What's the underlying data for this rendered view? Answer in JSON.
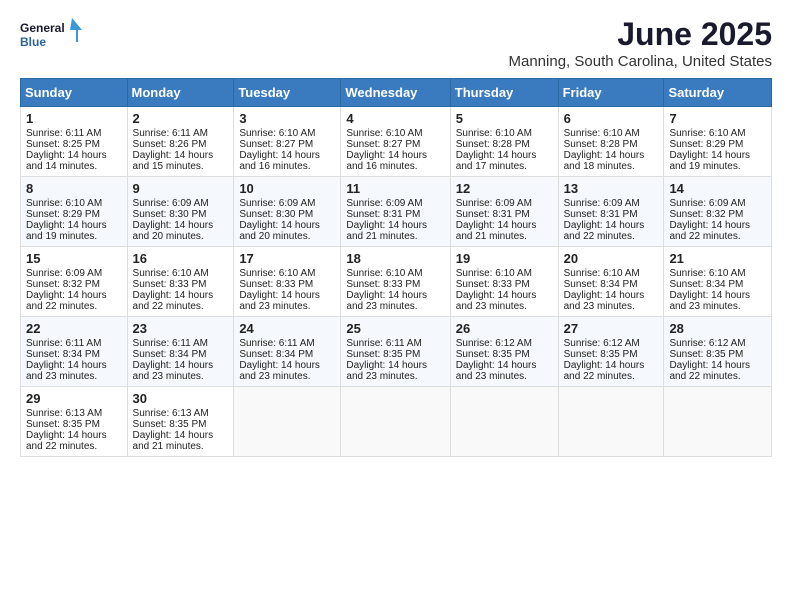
{
  "header": {
    "logo_line1": "General",
    "logo_line2": "Blue",
    "title": "June 2025",
    "subtitle": "Manning, South Carolina, United States"
  },
  "calendar": {
    "weekdays": [
      "Sunday",
      "Monday",
      "Tuesday",
      "Wednesday",
      "Thursday",
      "Friday",
      "Saturday"
    ],
    "weeks": [
      [
        {
          "day": "1",
          "info": "Sunrise: 6:11 AM\nSunset: 8:25 PM\nDaylight: 14 hours and 14 minutes."
        },
        {
          "day": "2",
          "info": "Sunrise: 6:11 AM\nSunset: 8:26 PM\nDaylight: 14 hours and 15 minutes."
        },
        {
          "day": "3",
          "info": "Sunrise: 6:10 AM\nSunset: 8:27 PM\nDaylight: 14 hours and 16 minutes."
        },
        {
          "day": "4",
          "info": "Sunrise: 6:10 AM\nSunset: 8:27 PM\nDaylight: 14 hours and 16 minutes."
        },
        {
          "day": "5",
          "info": "Sunrise: 6:10 AM\nSunset: 8:28 PM\nDaylight: 14 hours and 17 minutes."
        },
        {
          "day": "6",
          "info": "Sunrise: 6:10 AM\nSunset: 8:28 PM\nDaylight: 14 hours and 18 minutes."
        },
        {
          "day": "7",
          "info": "Sunrise: 6:10 AM\nSunset: 8:29 PM\nDaylight: 14 hours and 19 minutes."
        }
      ],
      [
        {
          "day": "8",
          "info": "Sunrise: 6:10 AM\nSunset: 8:29 PM\nDaylight: 14 hours and 19 minutes."
        },
        {
          "day": "9",
          "info": "Sunrise: 6:09 AM\nSunset: 8:30 PM\nDaylight: 14 hours and 20 minutes."
        },
        {
          "day": "10",
          "info": "Sunrise: 6:09 AM\nSunset: 8:30 PM\nDaylight: 14 hours and 20 minutes."
        },
        {
          "day": "11",
          "info": "Sunrise: 6:09 AM\nSunset: 8:31 PM\nDaylight: 14 hours and 21 minutes."
        },
        {
          "day": "12",
          "info": "Sunrise: 6:09 AM\nSunset: 8:31 PM\nDaylight: 14 hours and 21 minutes."
        },
        {
          "day": "13",
          "info": "Sunrise: 6:09 AM\nSunset: 8:31 PM\nDaylight: 14 hours and 22 minutes."
        },
        {
          "day": "14",
          "info": "Sunrise: 6:09 AM\nSunset: 8:32 PM\nDaylight: 14 hours and 22 minutes."
        }
      ],
      [
        {
          "day": "15",
          "info": "Sunrise: 6:09 AM\nSunset: 8:32 PM\nDaylight: 14 hours and 22 minutes."
        },
        {
          "day": "16",
          "info": "Sunrise: 6:10 AM\nSunset: 8:33 PM\nDaylight: 14 hours and 22 minutes."
        },
        {
          "day": "17",
          "info": "Sunrise: 6:10 AM\nSunset: 8:33 PM\nDaylight: 14 hours and 23 minutes."
        },
        {
          "day": "18",
          "info": "Sunrise: 6:10 AM\nSunset: 8:33 PM\nDaylight: 14 hours and 23 minutes."
        },
        {
          "day": "19",
          "info": "Sunrise: 6:10 AM\nSunset: 8:33 PM\nDaylight: 14 hours and 23 minutes."
        },
        {
          "day": "20",
          "info": "Sunrise: 6:10 AM\nSunset: 8:34 PM\nDaylight: 14 hours and 23 minutes."
        },
        {
          "day": "21",
          "info": "Sunrise: 6:10 AM\nSunset: 8:34 PM\nDaylight: 14 hours and 23 minutes."
        }
      ],
      [
        {
          "day": "22",
          "info": "Sunrise: 6:11 AM\nSunset: 8:34 PM\nDaylight: 14 hours and 23 minutes."
        },
        {
          "day": "23",
          "info": "Sunrise: 6:11 AM\nSunset: 8:34 PM\nDaylight: 14 hours and 23 minutes."
        },
        {
          "day": "24",
          "info": "Sunrise: 6:11 AM\nSunset: 8:34 PM\nDaylight: 14 hours and 23 minutes."
        },
        {
          "day": "25",
          "info": "Sunrise: 6:11 AM\nSunset: 8:35 PM\nDaylight: 14 hours and 23 minutes."
        },
        {
          "day": "26",
          "info": "Sunrise: 6:12 AM\nSunset: 8:35 PM\nDaylight: 14 hours and 23 minutes."
        },
        {
          "day": "27",
          "info": "Sunrise: 6:12 AM\nSunset: 8:35 PM\nDaylight: 14 hours and 22 minutes."
        },
        {
          "day": "28",
          "info": "Sunrise: 6:12 AM\nSunset: 8:35 PM\nDaylight: 14 hours and 22 minutes."
        }
      ],
      [
        {
          "day": "29",
          "info": "Sunrise: 6:13 AM\nSunset: 8:35 PM\nDaylight: 14 hours and 22 minutes."
        },
        {
          "day": "30",
          "info": "Sunrise: 6:13 AM\nSunset: 8:35 PM\nDaylight: 14 hours and 21 minutes."
        },
        {
          "day": "",
          "info": ""
        },
        {
          "day": "",
          "info": ""
        },
        {
          "day": "",
          "info": ""
        },
        {
          "day": "",
          "info": ""
        },
        {
          "day": "",
          "info": ""
        }
      ]
    ]
  }
}
